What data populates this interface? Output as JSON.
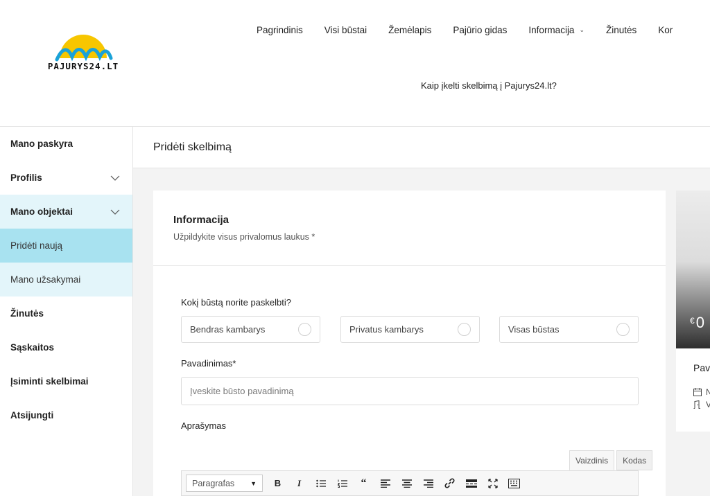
{
  "brand": {
    "logo_text": "PAJURYS24.LT",
    "colors": {
      "sun": "#f7c600",
      "wave": "#1aa2d8",
      "active_bg": "#a8e2f0",
      "open_bg": "#e3f5fa"
    }
  },
  "nav": {
    "items": [
      {
        "label": "Pagrindinis"
      },
      {
        "label": "Visi būstai"
      },
      {
        "label": "Žemėlapis"
      },
      {
        "label": "Pajūrio gidas"
      },
      {
        "label": "Informacija",
        "has_dropdown": true
      },
      {
        "label": "Žinutės"
      },
      {
        "label": "Kor"
      }
    ],
    "subnav_label": "Kaip įkelti skelbimą į Pajurys24.lt?"
  },
  "sidebar": {
    "items": [
      {
        "label": "Mano paskyra"
      },
      {
        "label": "Profilis",
        "icon": "chevron-down-icon"
      },
      {
        "label": "Mano objektai",
        "icon": "chevron-down-icon"
      },
      {
        "label": "Pridėti naują"
      },
      {
        "label": "Mano užsakymai"
      },
      {
        "label": "Žinutės"
      },
      {
        "label": "Sąskaitos"
      },
      {
        "label": "Įsiminti skelbimai"
      },
      {
        "label": "Atsijungti"
      }
    ]
  },
  "page": {
    "title": "Pridėti skelbimą"
  },
  "form": {
    "section_title": "Informacija",
    "section_subtitle": "Užpildykite visus privalomus laukus *",
    "type_question": "Kokį būstą norite paskelbti?",
    "type_options": [
      {
        "label": "Bendras kambarys"
      },
      {
        "label": "Privatus kambarys"
      },
      {
        "label": "Visas būstas"
      }
    ],
    "name_label": "Pavadinimas*",
    "name_placeholder": "Įveskite būsto pavadinimą",
    "name_value": "",
    "description_label": "Aprašymas",
    "editor": {
      "tab_visual": "Vaizdinis",
      "tab_code": "Kodas",
      "format_select": "Paragrafas",
      "tools": [
        {
          "icon": "bold-icon",
          "glyph": "B"
        },
        {
          "icon": "italic-icon",
          "glyph": "I"
        },
        {
          "icon": "bullet-list-icon",
          "glyph": ""
        },
        {
          "icon": "numbered-list-icon",
          "glyph": ""
        },
        {
          "icon": "blockquote-icon",
          "glyph": "“"
        },
        {
          "icon": "align-left-icon",
          "glyph": ""
        },
        {
          "icon": "align-center-icon",
          "glyph": ""
        },
        {
          "icon": "align-right-icon",
          "glyph": ""
        },
        {
          "icon": "link-icon",
          "glyph": ""
        },
        {
          "icon": "read-more-icon",
          "glyph": ""
        },
        {
          "icon": "fullscreen-icon",
          "glyph": ""
        },
        {
          "icon": "keyboard-icon",
          "glyph": ""
        }
      ]
    }
  },
  "preview": {
    "currency": "€",
    "price": "0",
    "name": "Pav",
    "row1": "N",
    "row2": "V"
  }
}
